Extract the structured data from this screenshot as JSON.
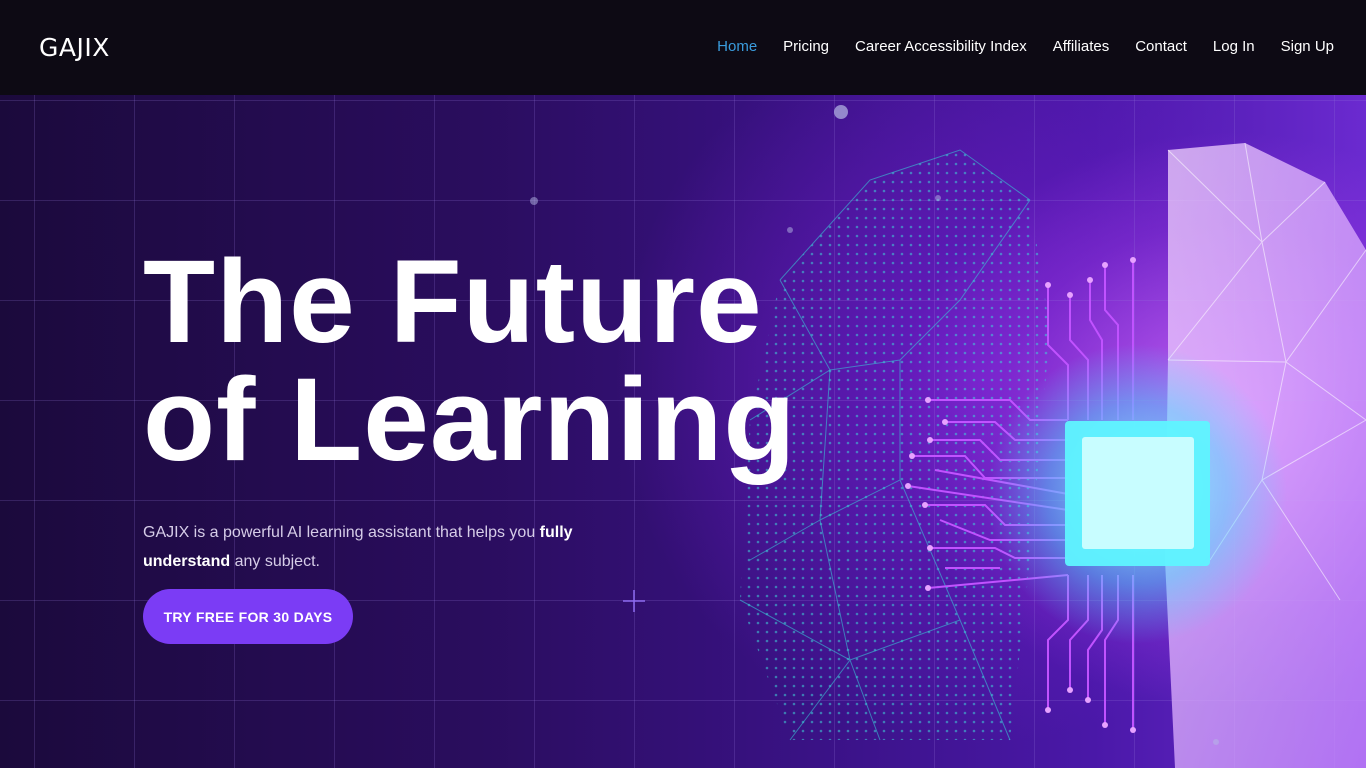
{
  "header": {
    "logo": "GAJIX",
    "nav": [
      {
        "label": "Home",
        "active": true
      },
      {
        "label": "Pricing"
      },
      {
        "label": "Career Accessibility Index"
      },
      {
        "label": "Affiliates"
      },
      {
        "label": "Contact"
      },
      {
        "label": "Log In"
      },
      {
        "label": "Sign Up"
      }
    ]
  },
  "hero": {
    "headline_line1": "The Future",
    "headline_line2": "of Learning",
    "tagline": {
      "part1": "GAJIX is a powerful AI learning assistant that helps you ",
      "emphasis": "fully understand",
      "part2": " any subject."
    },
    "cta_label": "TRY FREE FOR 30 DAYS"
  },
  "colors": {
    "accent": "#7b3cf5",
    "nav_active": "#3a9bdc",
    "nav_background": "#0d0a14",
    "hero_background": "#2a0d5e",
    "chip_glow": "#5ff4ff"
  }
}
